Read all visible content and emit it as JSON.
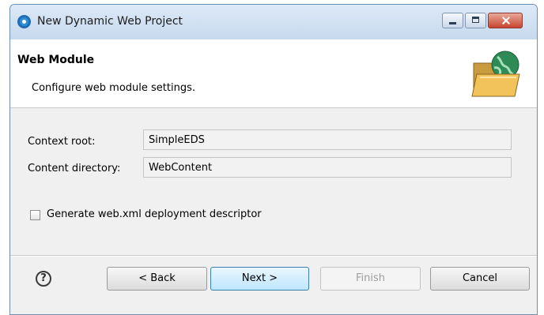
{
  "window": {
    "title": "New Dynamic Web Project"
  },
  "header": {
    "title": "Web Module",
    "description": "Configure web module settings."
  },
  "fields": {
    "context_root": {
      "label": "Context root:",
      "value": "SimpleEDS"
    },
    "content_directory": {
      "label": "Content directory:",
      "value": "WebContent"
    }
  },
  "options": {
    "generate_web_xml": {
      "label": "Generate web.xml deployment descriptor",
      "checked": false
    }
  },
  "footer": {
    "help_glyph": "?",
    "back_label": "< Back",
    "next_label": "Next >",
    "finish_label": "Finish",
    "cancel_label": "Cancel",
    "finish_enabled": false
  },
  "icons": {
    "app": "eclipse-icon",
    "banner": "web-folder-globe-icon",
    "help": "help-icon"
  },
  "colors": {
    "titlebar": "#c7d9ee",
    "close_button": "#c8452f",
    "default_button": "#bee6fd"
  }
}
